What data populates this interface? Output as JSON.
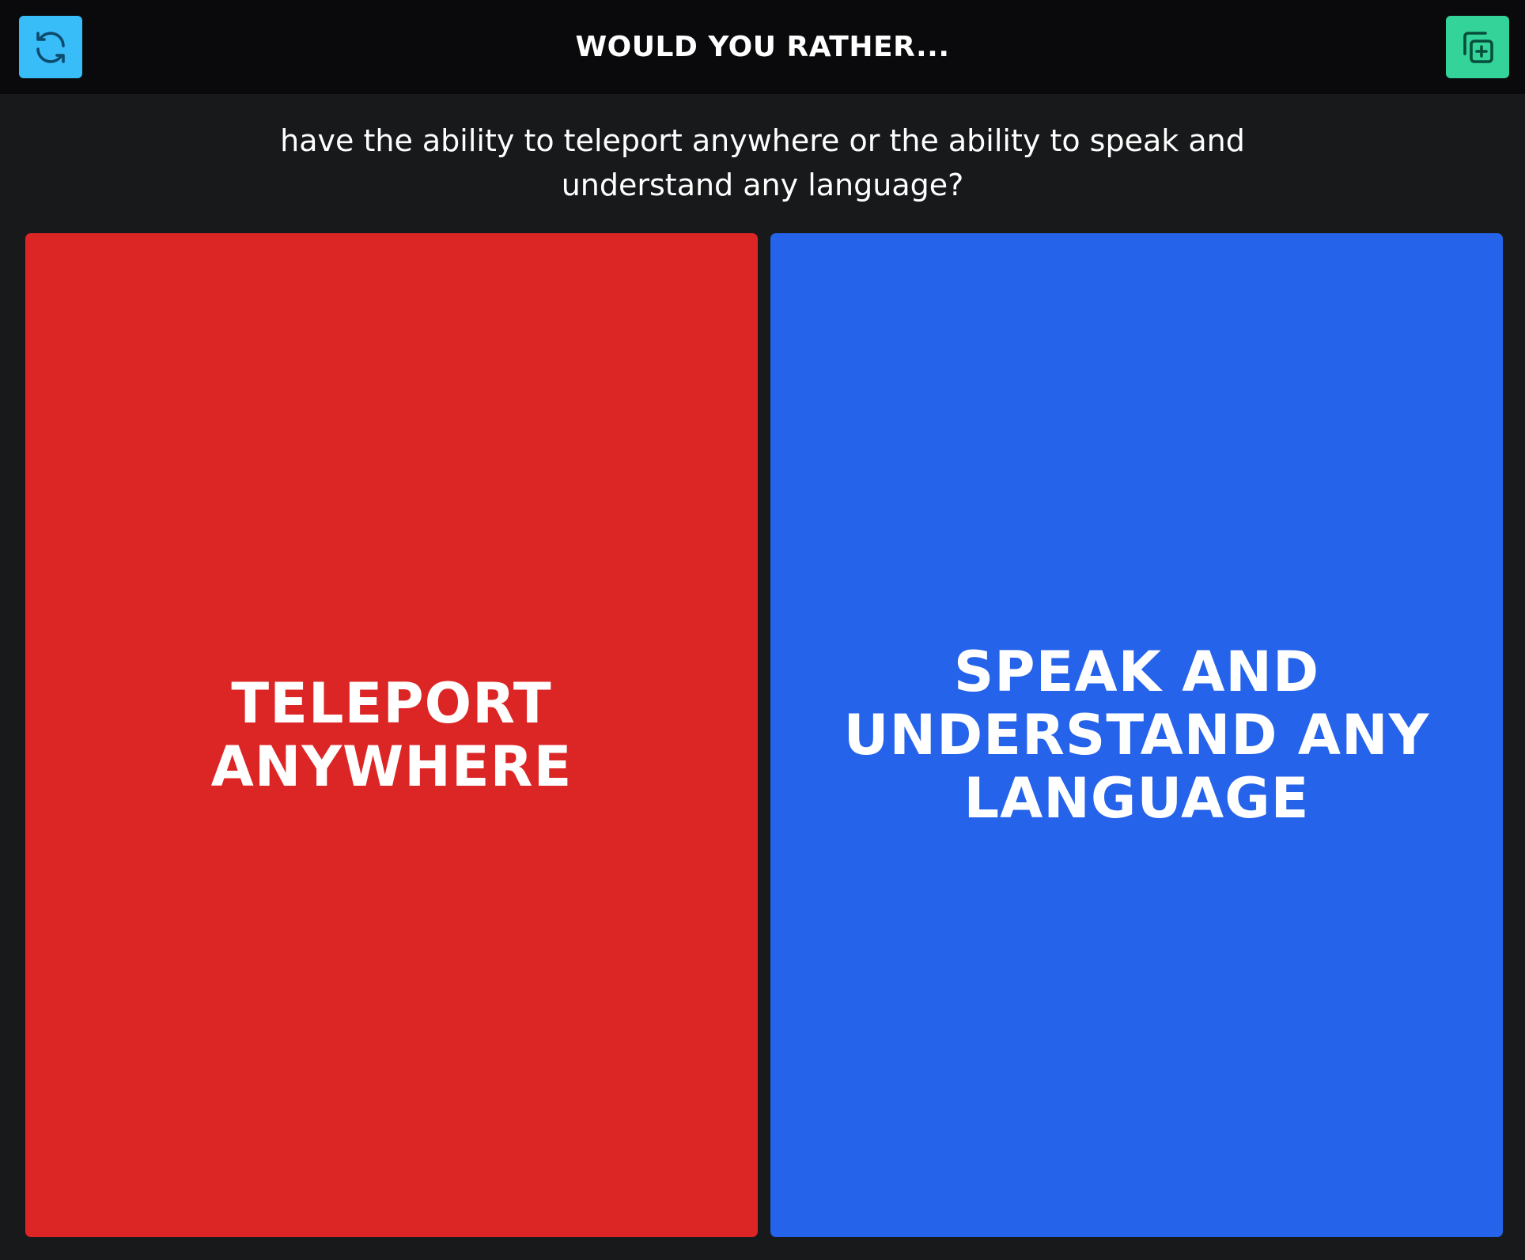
{
  "header": {
    "title": "WOULD YOU RATHER...",
    "refresh_icon": "refresh-icon",
    "add_icon": "copy-plus-icon"
  },
  "question": "have the ability to teleport anywhere or the ability to speak and understand any language?",
  "options": [
    {
      "label": "TELEPORT ANYWHERE",
      "color": "#dc2626"
    },
    {
      "label": "SPEAK AND UNDERSTAND ANY LANGUAGE",
      "color": "#2563eb"
    }
  ],
  "colors": {
    "background": "#18191b",
    "topbar": "#0a0a0c",
    "refresh_button": "#38bdf8",
    "add_button": "#34d399"
  }
}
